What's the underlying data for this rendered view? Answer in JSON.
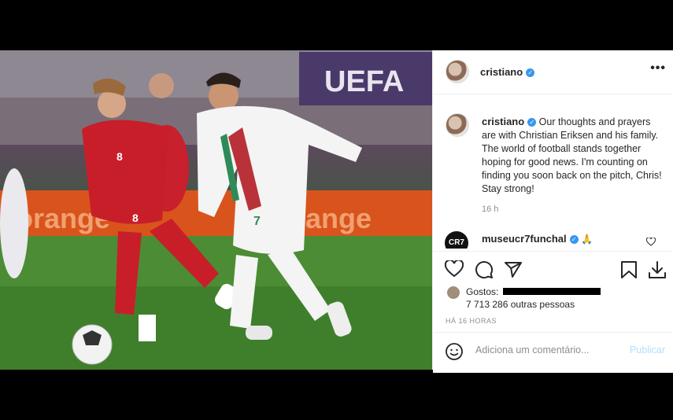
{
  "post": {
    "username": "cristiano",
    "verified_glyph": "✓",
    "more_label": "•••",
    "caption": "Our thoughts and prayers are with Christian Eriksen and his family. The world of football stands together hoping for good news. I'm counting on finding you soon back on the pitch, Chris! Stay strong!",
    "caption_time": "16 h",
    "photo_banner_text": "UEFA",
    "photo_board_text": "orange",
    "jersey_numbers": [
      "8",
      "8",
      "7"
    ]
  },
  "comment": {
    "username": "museucr7funchal",
    "avatar_text": "CR7",
    "emoji": "🙏"
  },
  "footer": {
    "likes_prefix": "Gostos:",
    "likes_count": "7 713 286 outras pessoas",
    "timestamp": "HÁ 16 HORAS",
    "comment_placeholder": "Adiciona um comentário...",
    "publish_label": "Publicar"
  },
  "colors": {
    "verified": "#3897f0",
    "publish": "#b2dffc",
    "muted": "#8e8e8e",
    "text": "#262626"
  },
  "icons": [
    "heart-icon",
    "comment-icon",
    "share-icon",
    "bookmark-icon",
    "download-icon",
    "emoji-icon",
    "small-heart-icon"
  ]
}
